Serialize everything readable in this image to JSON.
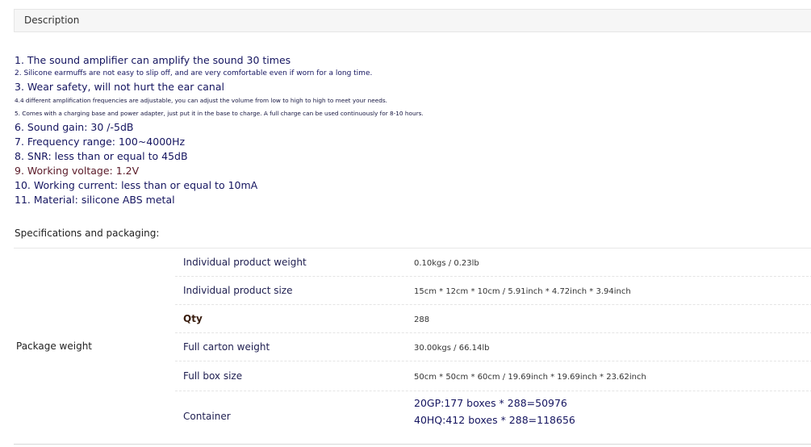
{
  "description_tab": {
    "label": "Description"
  },
  "description_lines": [
    {
      "text": "1. The sound amplifier can amplify the sound 30 times",
      "style": "big"
    },
    {
      "text": "2. Silicone earmuffs are not easy to slip off, and are very comfortable even if worn for a long time.",
      "style": "small"
    },
    {
      "text": "3. Wear safety, will not hurt the ear canal",
      "style": "big"
    },
    {
      "text": "4.4 different amplification frequencies are adjustable, you can adjust the volume from low to high to high to meet your needs.",
      "style": "tiny"
    },
    {
      "text": "5. Comes with a charging base and power adapter, just put it in the base to charge. A full charge can be used continuously for 8-10 hours.",
      "style": "tiny"
    },
    {
      "text": "6. Sound gain: 30 /-5dB",
      "style": "big"
    },
    {
      "text": "7. Frequency range: 100~4000Hz",
      "style": "big"
    },
    {
      "text": "8. SNR: less than or equal to 45dB",
      "style": "big"
    },
    {
      "text": "9. Working voltage: 1.2V",
      "style": "big maroon"
    },
    {
      "text": "10. Working current: less than or equal to 10mA",
      "style": "big"
    },
    {
      "text": "11. Material: silicone ABS metal",
      "style": "big"
    }
  ],
  "specs": {
    "title": "Specifications and packaging:",
    "group_label": "Package weight",
    "rows": [
      {
        "key": "Individual product weight",
        "value": "0.10kgs / 0.23lb"
      },
      {
        "key": "Individual product size",
        "value": "15cm * 12cm * 10cm / 5.91inch * 4.72inch * 3.94inch"
      },
      {
        "key": "Qty",
        "value": "288"
      },
      {
        "key": "Full carton weight",
        "value": "30.00kgs / 66.14lb"
      },
      {
        "key": "Full box size",
        "value": "50cm * 50cm * 60cm / 19.69inch * 19.69inch * 23.62inch"
      }
    ],
    "container": {
      "key": "Container",
      "lines": [
        "20GP:177 boxes * 288=50976",
        "40HQ:412 boxes * 288=118656"
      ]
    }
  }
}
